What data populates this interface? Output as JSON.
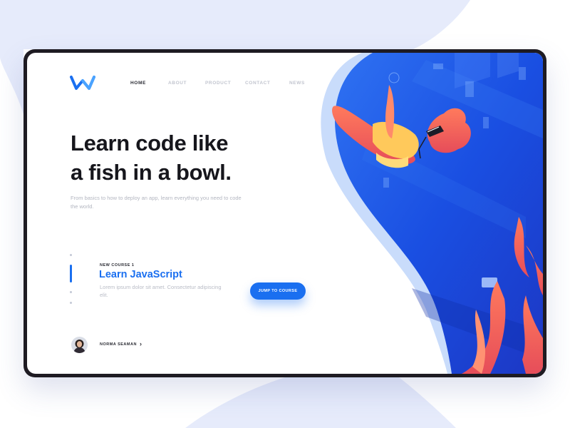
{
  "nav": {
    "items": [
      {
        "label": "HOME",
        "active": true
      },
      {
        "label": "ABOUT",
        "active": false
      },
      {
        "label": "PRODUCT",
        "active": false
      },
      {
        "label": "CONTACT",
        "active": false
      },
      {
        "label": "NEWS",
        "active": false
      }
    ]
  },
  "hero": {
    "title_line1": "Learn code like",
    "title_line2": "a fish in a bowl.",
    "subtitle": "From basics to how to deploy an app, learn everything you need to code the world."
  },
  "course": {
    "label": "NEW COURSE 1",
    "title": "Learn JavaScript",
    "description": "Lorem ipsum dolor sit amet. Consectetur adipiscing elit."
  },
  "cta": {
    "label": "JUMP TO COURSE"
  },
  "author": {
    "name": "NORMA SEAMAN"
  },
  "icons": {
    "logo": "brand-logo-icon",
    "chevron": "chevron-right-icon",
    "avatar": "avatar-image"
  },
  "colors": {
    "accent": "#1a6ff0",
    "title": "#16161c",
    "page_bg_blob": "#e4e9fb",
    "frame": "#1e1b22",
    "illustration_blue": "#1b4fe0",
    "illustration_coral": "#f46a56"
  }
}
